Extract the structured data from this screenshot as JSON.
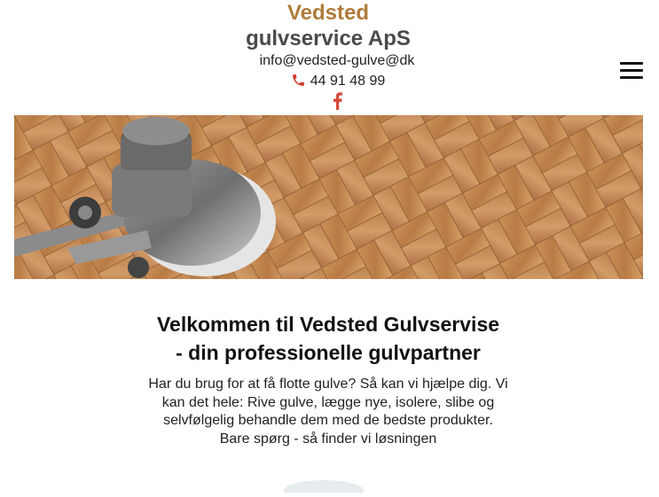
{
  "header": {
    "brand_line1": "Vedsted",
    "brand_line2": "gulvservice ApS",
    "email": "info@vedsted-gulve@dk",
    "phone": "44 91 48 99"
  },
  "icons": {
    "phone": "phone-icon",
    "facebook": "facebook-icon",
    "menu": "hamburger-menu-icon"
  },
  "colors": {
    "brand_accent": "#b07c3c",
    "brand_dark": "#4a4a4a",
    "phone_icon": "#d23b2f",
    "facebook_icon": "#d84a3a"
  },
  "welcome": {
    "title_line1": "Velkommen til Vedsted Gulvservise",
    "title_line2": "- din professionelle gulvpartner",
    "intro_lines": [
      "Har du brug for at få flotte gulve? Så kan vi hjælpe dig. Vi",
      "kan det hele: Rive gulve, lægge nye, isolere, slibe og",
      "selvfølgelig behandle dem med de bedste produkter.",
      "Bare spørg - så finder vi løsningen"
    ]
  }
}
